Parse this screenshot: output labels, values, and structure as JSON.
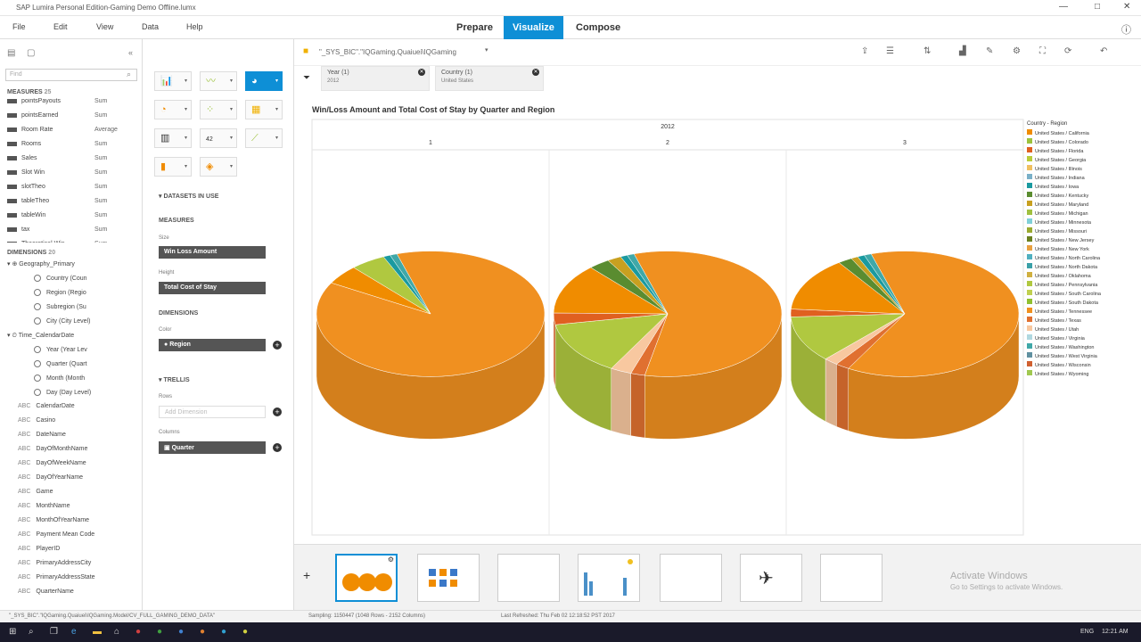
{
  "window": {
    "title": "SAP Lumira Personal Edition-Gaming Demo Offline.lumx",
    "min": "—",
    "max": "□",
    "close": "✕"
  },
  "menu": [
    "File",
    "Edit",
    "View",
    "Data",
    "Help"
  ],
  "modes": [
    "Prepare",
    "Visualize",
    "Compose"
  ],
  "left": {
    "search_placeholder": "Find",
    "measures_label": "MEASURES",
    "measures_count": "25",
    "measures": [
      {
        "name": "pointsPayouts",
        "agg": "Sum"
      },
      {
        "name": "pointsEarned",
        "agg": "Sum"
      },
      {
        "name": "Room Rate",
        "agg": "Average"
      },
      {
        "name": "Rooms",
        "agg": "Sum"
      },
      {
        "name": "Sales",
        "agg": "Sum"
      },
      {
        "name": "Slot Win",
        "agg": "Sum"
      },
      {
        "name": "slotTheo",
        "agg": "Sum"
      },
      {
        "name": "tableTheo",
        "agg": "Sum"
      },
      {
        "name": "tableWin",
        "agg": "Sum"
      },
      {
        "name": "tax",
        "agg": "Sum"
      },
      {
        "name": "Theoretical Win",
        "agg": "Sum"
      }
    ],
    "dimensions_label": "DIMENSIONS",
    "dimensions_count": "20",
    "hier_geo": "Geography_Primary",
    "geo_levels": [
      "Country (Coun",
      "Region (Regio",
      "Subregion (Su",
      "City (City Level)"
    ],
    "hier_time": "Time_CalendarDate",
    "time_levels": [
      "Year (Year Lev",
      "Quarter (Quart",
      "Month (Month",
      "Day (Day Level)"
    ],
    "dims": [
      "CalendarDate",
      "Casino",
      "DateName",
      "DayOfMonthName",
      "DayOfWeekName",
      "DayOfYearName",
      "Game",
      "MonthName",
      "MonthOfYearName",
      "Payment Mean Code",
      "PlayerID",
      "PrimaryAddressCity",
      "PrimaryAddressState",
      "QuarterName"
    ],
    "dim_prefix": "ABC"
  },
  "mid": {
    "datasets_label": "DATASETS IN USE",
    "measures_label": "MEASURES",
    "size_label": "Size",
    "size_value": "Win Loss Amount",
    "height_label": "Height",
    "height_value": "Total Cost of Stay",
    "dimensions_label": "DIMENSIONS",
    "color_label": "Color",
    "color_value": "Region",
    "trellis_label": "TRELLIS",
    "rows_label": "Rows",
    "rows_placeholder": "Add Dimension",
    "columns_label": "Columns",
    "columns_value": "Quarter"
  },
  "topbar": {
    "dataset": "\"_SYS_BIC\".\"IQGaming.Quaiuei\\IQGaming"
  },
  "filters": [
    {
      "name": "Year (1)",
      "value": "2012"
    },
    {
      "name": "Country (1)",
      "value": "United States"
    }
  ],
  "chart_data": {
    "type": "pie",
    "title": "Win/Loss Amount and Total Cost of Stay by Quarter and Region",
    "trellis_header": "2012",
    "columns": [
      "1",
      "2",
      "3"
    ],
    "legend_title": "Country - Region",
    "legend": [
      "United States / California",
      "United States / Colorado",
      "United States / Florida",
      "United States / Georgia",
      "United States / Illinois",
      "United States / Indiana",
      "United States / Iowa",
      "United States / Kentucky",
      "United States / Maryland",
      "United States / Michigan",
      "United States / Minnesota",
      "United States / Missouri",
      "United States / New Jersey",
      "United States / New York",
      "United States / North Carolina",
      "United States / North Dakota",
      "United States / Oklahoma",
      "United States / Pennsylvania",
      "United States / South Carolina",
      "United States / South Dakota",
      "United States / Tennessee",
      "United States / Texas",
      "United States / Utah",
      "United States / Virginia",
      "United States / Washington",
      "United States / West Virginia",
      "United States / Wisconsin",
      "United States / Wyoming"
    ],
    "legend_colors": [
      "#f08c00",
      "#9cc23c",
      "#e06020",
      "#b9cc3a",
      "#f0c060",
      "#7ab0c8",
      "#1a9aa0",
      "#5a8c30",
      "#c8a020",
      "#a0c040",
      "#80d0d8",
      "#9aaa30",
      "#6a8020",
      "#e8a040",
      "#50b0c0",
      "#3aa0a8",
      "#d0b040",
      "#b0c840",
      "#c0d050",
      "#90c030",
      "#f09020",
      "#e07030",
      "#f8c8a0",
      "#b0d8e0",
      "#40a8a8",
      "#6090a0",
      "#d06030",
      "#a0c850"
    ],
    "pies": [
      {
        "q": "1",
        "slices": [
          {
            "region": "United States / Tennessee",
            "value": 88.0
          },
          {
            "region": "United States / California",
            "value": 5.0
          },
          {
            "region": "United States / Pennsylvania",
            "value": 5.0
          },
          {
            "region": "United States / Iowa",
            "value": 1.0
          },
          {
            "region": "United States / Washington",
            "value": 1.0
          }
        ]
      },
      {
        "q": "2",
        "slices": [
          {
            "region": "United States / Tennessee",
            "value": 58.0
          },
          {
            "region": "United States / Texas",
            "value": 2.0
          },
          {
            "region": "United States / Utah",
            "value": 3.0
          },
          {
            "region": "United States / Pennsylvania",
            "value": 14.0
          },
          {
            "region": "United States / Florida",
            "value": 3.0
          },
          {
            "region": "United States / California",
            "value": 13.0
          },
          {
            "region": "United States / Kentucky",
            "value": 3.0
          },
          {
            "region": "United States / Maryland",
            "value": 2.0
          },
          {
            "region": "United States / Iowa",
            "value": 1.0
          },
          {
            "region": "United States / Washington",
            "value": 1.0
          }
        ]
      },
      {
        "q": "3",
        "slices": [
          {
            "region": "United States / Tennessee",
            "value": 63.0
          },
          {
            "region": "United States / Texas",
            "value": 2.0
          },
          {
            "region": "United States / Utah",
            "value": 2.0
          },
          {
            "region": "United States / Pennsylvania",
            "value": 12.0
          },
          {
            "region": "United States / Florida",
            "value": 2.0
          },
          {
            "region": "United States / California",
            "value": 14.0
          },
          {
            "region": "United States / Kentucky",
            "value": 2.0
          },
          {
            "region": "United States / Maryland",
            "value": 1.0
          },
          {
            "region": "United States / Iowa",
            "value": 1.0
          },
          {
            "region": "United States / Washington",
            "value": 1.0
          }
        ]
      }
    ]
  },
  "status": {
    "path": "\"_SYS_BIC\".\"IQGaming.Quaiuei\\IQGaming.Model/CV_FULL_GAMING_DEMO_DATA\"",
    "sampling": "Sampling: 1150447 (1048 Rows - 2152 Columns)",
    "refreshed": "Last Refreshed: Thu Feb 02 12:18:52 PST 2017"
  },
  "watermark": {
    "line1": "Activate Windows",
    "line2": "Go to Settings to activate Windows."
  },
  "taskbar": {
    "time": "12:21 AM",
    "lang": "ENG"
  },
  "colors": {
    "accent": "#0e8fd6",
    "pie_orange": "#f08c00",
    "pie_green": "#b9cc3a"
  }
}
